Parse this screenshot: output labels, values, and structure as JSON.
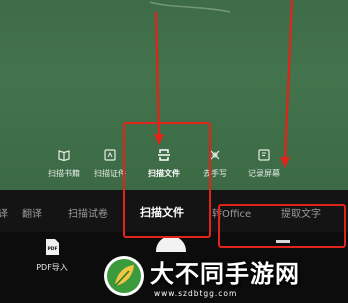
{
  "tools": [
    {
      "label": "扫描书籍",
      "icon": "book-icon"
    },
    {
      "label": "扫描证件",
      "icon": "id-card-icon"
    },
    {
      "label": "扫描文件",
      "icon": "document-scan-icon",
      "active": true
    },
    {
      "label": "去手写",
      "icon": "eraser-icon"
    },
    {
      "label": "记录屏幕",
      "icon": "screen-record-icon"
    }
  ],
  "modes": [
    "译",
    "翻译",
    "扫描试卷",
    "扫描文件",
    "转Office",
    "提取文字"
  ],
  "active_mode": "扫描文件",
  "bottom": {
    "pdf_import_label": "PDF导入",
    "pdf_badge": "PDF"
  },
  "watermark": {
    "title": "大不同手游网",
    "url": "www.szdbtgg.com"
  },
  "colors": {
    "highlight": "#e2231a",
    "board": "#43744d",
    "watermark_green": "#3b9a3b"
  }
}
